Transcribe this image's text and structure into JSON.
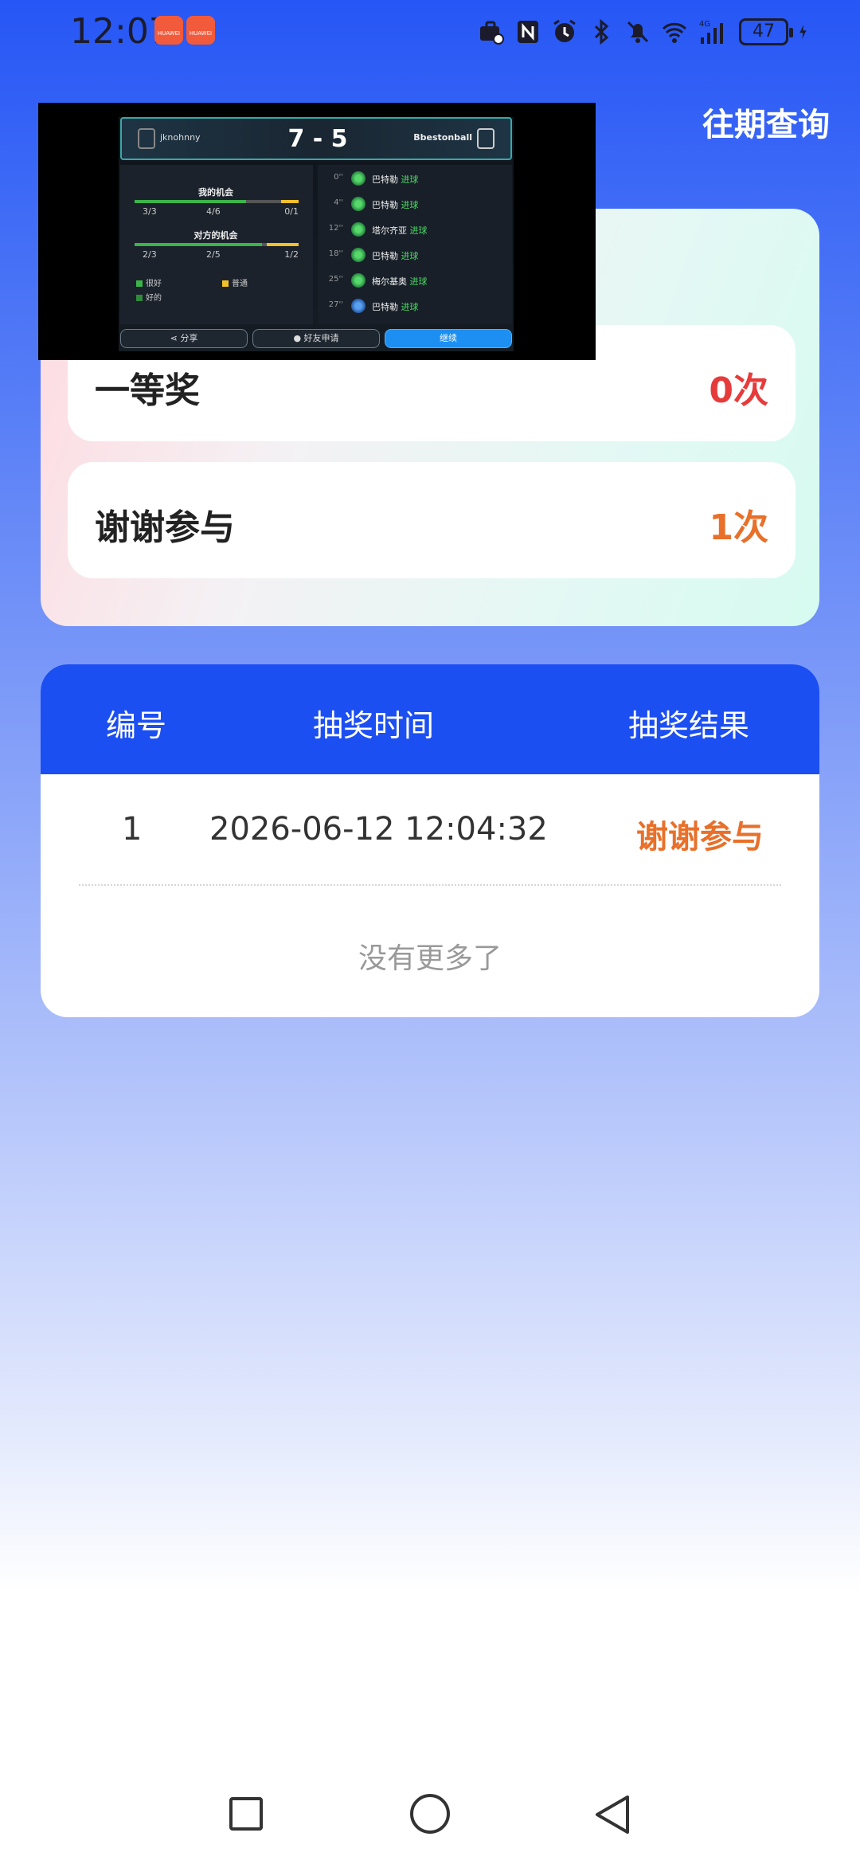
{
  "status_bar": {
    "time": "12:07",
    "app_badges": [
      "HUAWEI",
      "HUAWEI"
    ],
    "network": "4G",
    "battery": "47"
  },
  "header": {
    "history_label": "往期查询"
  },
  "prizes": [
    {
      "name": "一等奖",
      "count": "0次",
      "color": "#e63b3b"
    },
    {
      "name": "谢谢参与",
      "count": "1次",
      "color": "#e8702a"
    }
  ],
  "overlay": {
    "player1": "jknohnny",
    "player2": "Bbestonball",
    "score": "7 - 5",
    "my_chances_title": "我的机会",
    "my_chances": [
      "3/3",
      "4/6",
      "0/1"
    ],
    "opp_chances_title": "对方的机会",
    "opp_chances": [
      "2/3",
      "2/5",
      "1/2"
    ],
    "legend": [
      "很好",
      "普通",
      "好的"
    ],
    "events": [
      {
        "minute": "0''",
        "player": "巴特勒",
        "action": "进球"
      },
      {
        "minute": "4''",
        "player": "巴特勒",
        "action": "进球"
      },
      {
        "minute": "12''",
        "player": "塔尔齐亚",
        "action": "进球"
      },
      {
        "minute": "18''",
        "player": "巴特勒",
        "action": "进球"
      },
      {
        "minute": "25''",
        "player": "梅尔基奥",
        "action": "进球"
      },
      {
        "minute": "27''",
        "player": "巴特勒",
        "action": "进球"
      }
    ],
    "share_label": "分享",
    "friend_label": "好友申请",
    "continue_label": "继续"
  },
  "table": {
    "headers": [
      "编号",
      "抽奖时间",
      "抽奖结果"
    ],
    "rows": [
      {
        "id": "1",
        "time": "2026-06-12 12:04:32",
        "result": "谢谢参与"
      }
    ],
    "footer": "没有更多了"
  },
  "colors": {
    "primary_blue": "#1c4ff2",
    "result_orange": "#e8702a",
    "zero_red": "#e63b3b"
  }
}
